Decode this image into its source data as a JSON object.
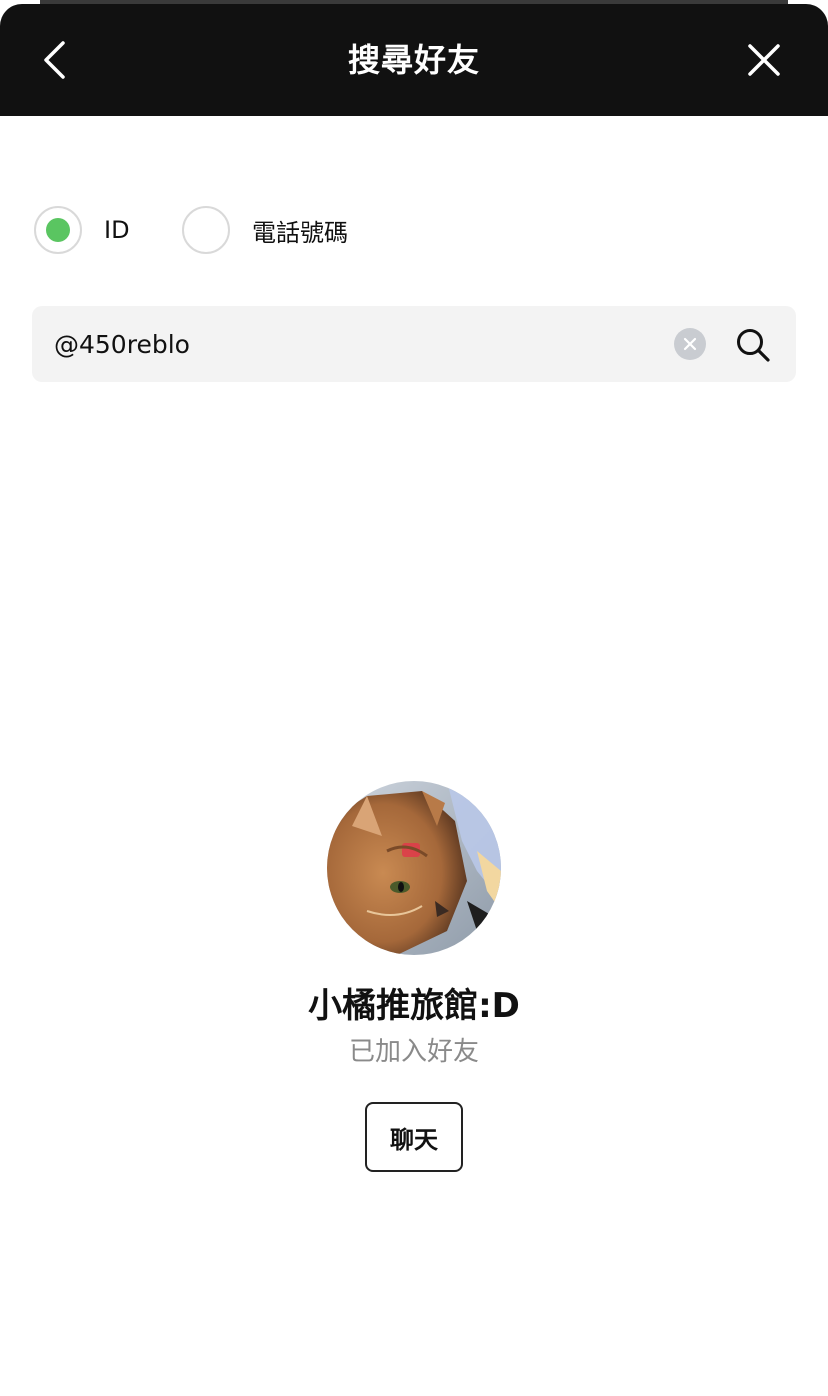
{
  "header": {
    "title": "搜尋好友",
    "back_icon": "chevron-left-icon",
    "close_icon": "close-icon"
  },
  "search_type": {
    "options": [
      {
        "label": "ID",
        "selected": true
      },
      {
        "label": "電話號碼",
        "selected": false
      }
    ]
  },
  "search": {
    "value": "@450reblo",
    "clear_icon": "clear-icon",
    "search_icon": "search-icon"
  },
  "result": {
    "name": "小橘推旅館:D",
    "status": "已加入好友",
    "chat_label": "聊天"
  },
  "colors": {
    "header_bg": "#111111",
    "accent_green": "#5ac561",
    "search_bg": "#f3f3f3",
    "status_gray": "#8a8a8a"
  }
}
